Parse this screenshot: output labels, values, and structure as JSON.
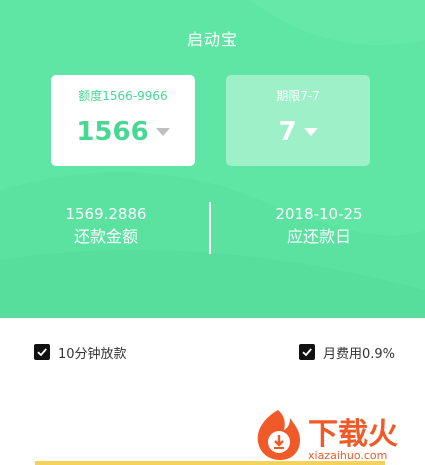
{
  "header": {
    "title": "启动宝"
  },
  "loan_amount": {
    "label": "额度1566-9966",
    "value": "1566"
  },
  "loan_term": {
    "label": "期限7-7",
    "value": "7"
  },
  "repayment_amount": {
    "value": "1569.2886",
    "label": "还款金额"
  },
  "due_date": {
    "value": "2018-10-25",
    "label": "应还款日"
  },
  "options": [
    {
      "label": "10分钟放款",
      "checked": true
    },
    {
      "label": "月费用0.9%",
      "checked": true
    }
  ],
  "watermark": {
    "brand": "下载火",
    "url": "xiazaihuo.com"
  },
  "colors": {
    "primary_green": "#5fe5a4",
    "accent_yellow": "#f5d35a",
    "watermark_orange": "#f05a28"
  }
}
